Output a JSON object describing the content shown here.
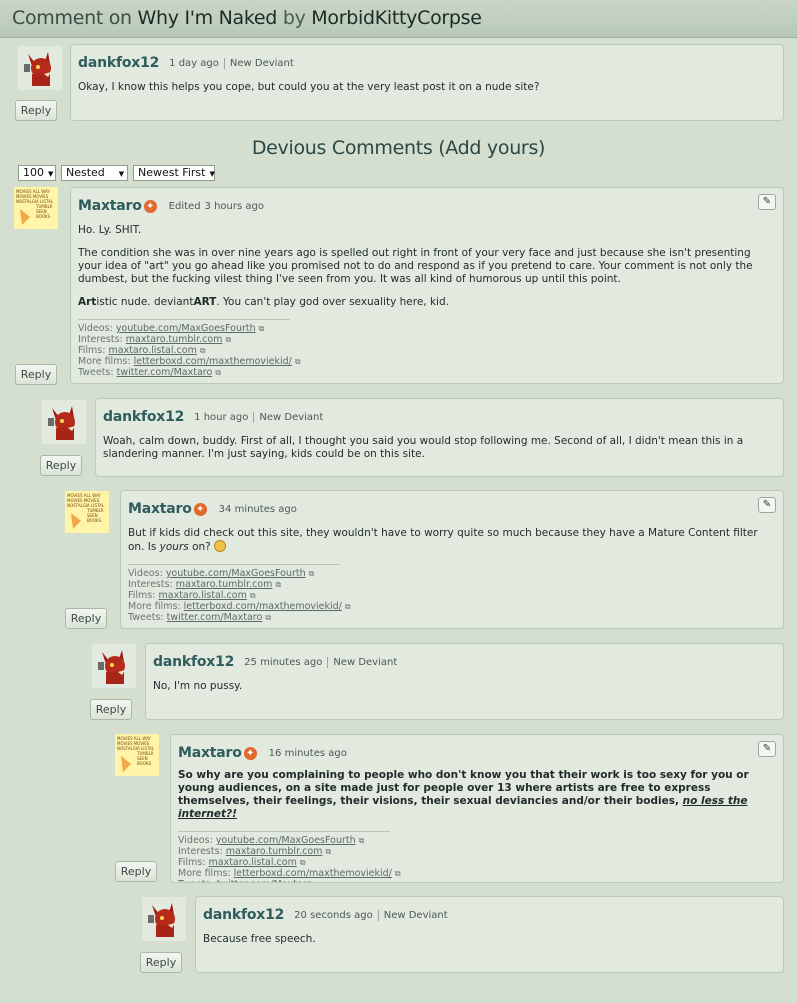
{
  "header": {
    "comment_on": "Comment on",
    "deviation": "Why I'm Naked",
    "by": "by",
    "author": "MorbidKittyCorpse"
  },
  "section_title": "Devious Comments (Add yours)",
  "filters": {
    "count": "100",
    "mode": "Nested",
    "order": "Newest First"
  },
  "reply_label": "Reply",
  "signature": {
    "videos_label": "Videos:",
    "videos": "youtube.com/MaxGoesFourth",
    "interests_label": "Interests:",
    "interests": "maxtaro.tumblr.com",
    "films_label": "Films:",
    "films": "maxtaro.listal.com",
    "more_films_label": "More films:",
    "more_films": "letterboxd.com/maxthemoviekid/",
    "tweets_label": "Tweets:",
    "tweets": "twitter.com/Maxtaro"
  },
  "comments": [
    {
      "user": "dankfox12",
      "time": "1 day ago",
      "group": "New Deviant",
      "body": "Okay, I know this helps you cope, but could you at the very least post it on a nude site?"
    },
    {
      "user": "Maxtaro",
      "edited": "Edited",
      "time": "3 hours ago",
      "p1": "Ho. Ly. SHIT.",
      "p2": "The condition she was in over nine years ago is spelled out right in front of your very face and just because she isn't presenting your idea of \"art\" you go ahead like you promised not to do and respond as if you pretend to care. Your comment is not only the dumbest, but the fucking vilest thing I've seen from you. It was all kind of humorous up until this point.",
      "p3_a": "Art",
      "p3_b": "istic nude. deviant",
      "p3_c": "ART",
      "p3_d": ". You can't play god over sexuality here, kid."
    },
    {
      "user": "dankfox12",
      "time": "1 hour ago",
      "group": "New Deviant",
      "body": "Woah, calm down, buddy. First of all, I thought you said you would stop following me. Second of all, I didn't mean this in a slandering manner. I'm just saying, kids could be on this site."
    },
    {
      "user": "Maxtaro",
      "time": "34 minutes ago",
      "body_a": "But if kids did check out this site, they wouldn't have to worry quite so much because they have a Mature Content filter on. Is ",
      "body_em": "yours",
      "body_b": " on?"
    },
    {
      "user": "dankfox12",
      "time": "25 minutes ago",
      "group": "New Deviant",
      "body": "No, I'm no pussy."
    },
    {
      "user": "Maxtaro",
      "time": "16 minutes ago",
      "body_a": "So why are you complaining to people who don't know you that their work is too sexy for you or young audiences, on a site made just for people over 13 where artists are free to express themselves, their feelings, their visions, their sexual deviancies and/or their bodies, ",
      "body_u": "no less the internet?!"
    },
    {
      "user": "dankfox12",
      "time": "20 seconds ago",
      "group": "New Deviant",
      "body": "Because free speech."
    }
  ]
}
